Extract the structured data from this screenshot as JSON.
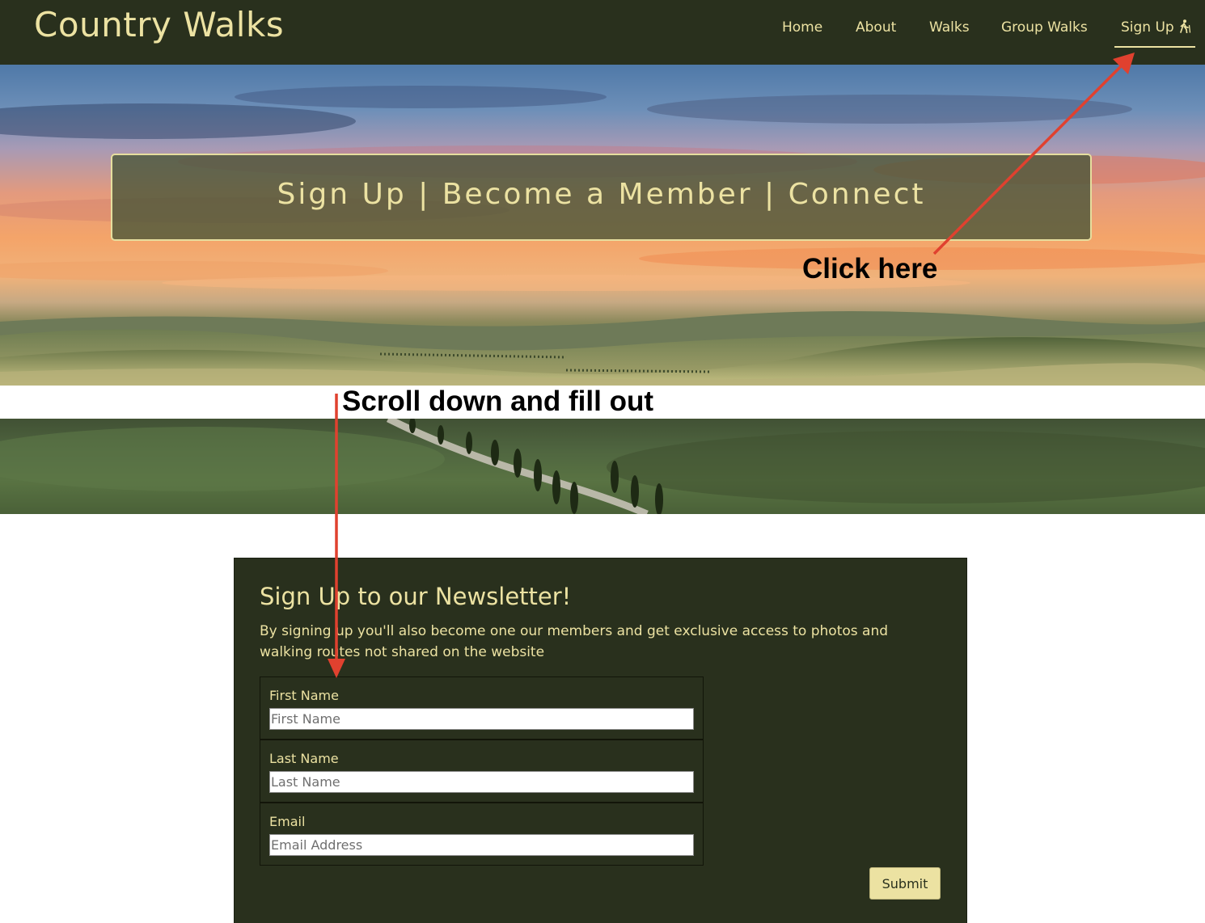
{
  "header": {
    "brand": "Country Walks",
    "nav": [
      {
        "label": "Home"
      },
      {
        "label": "About"
      },
      {
        "label": "Walks"
      },
      {
        "label": "Group Walks"
      },
      {
        "label": "Sign Up",
        "icon": "hiker-icon",
        "active": true
      }
    ]
  },
  "hero": {
    "banner_text": "Sign Up | Become a Member | Connect"
  },
  "form": {
    "title": "Sign Up to our Newsletter!",
    "description": "By signing up you'll also become one our members and get exclusive access to photos and walking routes not shared on the website",
    "fields": [
      {
        "label": "First Name",
        "placeholder": "First Name",
        "value": ""
      },
      {
        "label": "Last Name",
        "placeholder": "Last Name",
        "value": ""
      },
      {
        "label": "Email",
        "placeholder": "Email Address",
        "value": ""
      }
    ],
    "submit_label": "Submit"
  },
  "annotations": {
    "click_here": "Click here",
    "scroll_down": "Scroll down and fill out"
  },
  "colors": {
    "dark_green": "#29301d",
    "cream": "#ece2a2",
    "arrow_red": "#e0412f"
  }
}
